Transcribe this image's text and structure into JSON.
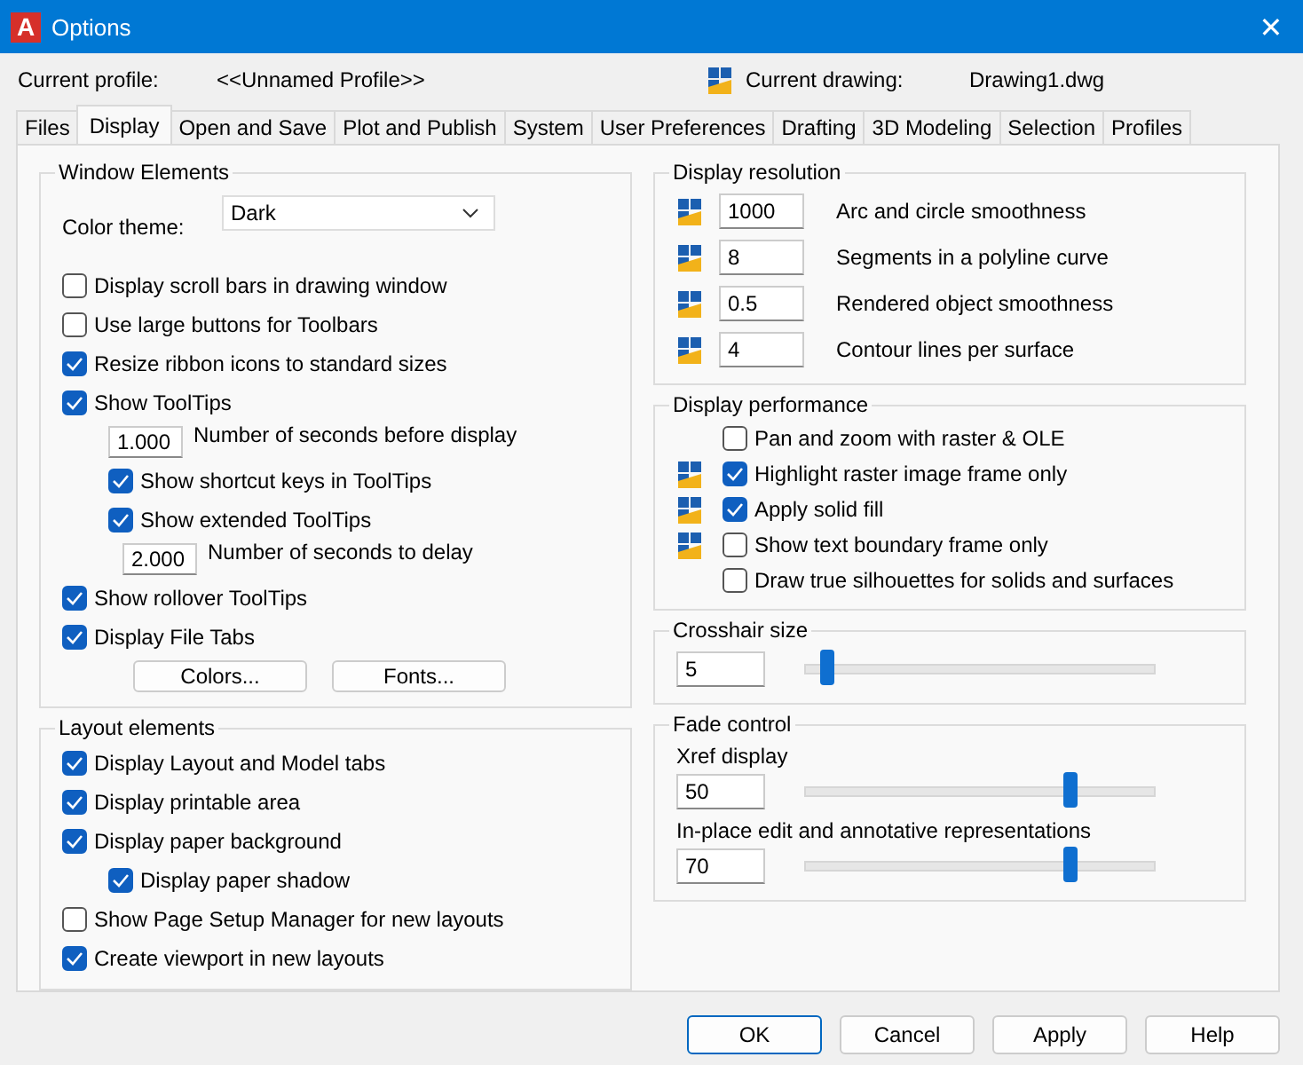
{
  "window": {
    "logo_letter": "A",
    "title": "Options",
    "close": "✕"
  },
  "profile": {
    "label": "Current profile:",
    "value": "<<Unnamed Profile>>",
    "drawing_label": "Current drawing:",
    "drawing_value": "Drawing1.dwg"
  },
  "tabs": [
    {
      "label": "Files",
      "selected": false
    },
    {
      "label": "Display",
      "selected": true
    },
    {
      "label": "Open and Save",
      "selected": false
    },
    {
      "label": "Plot and Publish",
      "selected": false
    },
    {
      "label": "System",
      "selected": false
    },
    {
      "label": "User Preferences",
      "selected": false
    },
    {
      "label": "Drafting",
      "selected": false
    },
    {
      "label": "3D Modeling",
      "selected": false
    },
    {
      "label": "Selection",
      "selected": false
    },
    {
      "label": "Profiles",
      "selected": false
    }
  ],
  "window_elements": {
    "title": "Window Elements",
    "items": [
      {
        "kind": "select",
        "label": "Color theme:",
        "value": "Dark"
      },
      {
        "kind": "checkbox",
        "label": "Display scroll bars in drawing window",
        "checked": false
      },
      {
        "kind": "checkbox",
        "label": "Use large buttons for Toolbars",
        "checked": false
      },
      {
        "kind": "checkbox",
        "label": "Resize ribbon icons to standard sizes",
        "checked": true
      },
      {
        "kind": "checkbox",
        "label": "Show ToolTips",
        "checked": true,
        "children": [
          {
            "kind": "number",
            "value": "1.000",
            "label": "Number of seconds before display"
          },
          {
            "kind": "checkbox",
            "label": "Show shortcut keys in ToolTips",
            "checked": true
          },
          {
            "kind": "checkbox",
            "label": "Show extended ToolTips",
            "checked": true,
            "children": [
              {
                "kind": "number",
                "value": "2.000",
                "label": "Number of seconds to delay"
              }
            ]
          }
        ]
      },
      {
        "kind": "checkbox",
        "label": "Show rollover ToolTips",
        "checked": true
      },
      {
        "kind": "checkbox",
        "label": "Display File Tabs",
        "checked": true
      },
      {
        "kind": "buttons",
        "labels": [
          "Colors...",
          "Fonts..."
        ]
      }
    ]
  },
  "layout_elements": {
    "title": "Layout elements",
    "items": [
      {
        "kind": "checkbox",
        "label": "Display Layout and Model tabs",
        "checked": true
      },
      {
        "kind": "checkbox",
        "label": "Display printable area",
        "checked": true
      },
      {
        "kind": "checkbox",
        "label": "Display paper background",
        "checked": true,
        "children": [
          {
            "kind": "checkbox",
            "label": "Display paper shadow",
            "checked": true
          }
        ]
      },
      {
        "kind": "checkbox",
        "label": "Show Page Setup Manager for new layouts",
        "checked": false
      },
      {
        "kind": "checkbox",
        "label": "Create viewport in new layouts",
        "checked": true
      }
    ]
  },
  "display_resolution": {
    "title": "Display resolution",
    "rows": [
      {
        "value": "1000",
        "label": "Arc and circle smoothness"
      },
      {
        "value": "8",
        "label": "Segments in a polyline curve"
      },
      {
        "value": "0.5",
        "label": "Rendered object smoothness"
      },
      {
        "value": "4",
        "label": "Contour lines per surface"
      }
    ]
  },
  "display_performance": {
    "title": "Display performance",
    "rows": [
      {
        "label": "Pan and zoom with raster & OLE",
        "checked": false,
        "drawing_icon": false
      },
      {
        "label": "Highlight raster image frame only",
        "checked": true,
        "drawing_icon": true
      },
      {
        "label": "Apply solid fill",
        "checked": true,
        "drawing_icon": true
      },
      {
        "label": "Show text boundary frame only",
        "checked": false,
        "drawing_icon": true
      },
      {
        "label": "Draw true silhouettes for solids and surfaces",
        "checked": false,
        "drawing_icon": false
      }
    ]
  },
  "crosshair": {
    "title": "Crosshair size",
    "value": "5",
    "level": 0.06
  },
  "fade_control": {
    "title": "Fade control",
    "sliders": [
      {
        "label": "Xref display",
        "value": "50",
        "level": 0.76
      },
      {
        "label": "In-place edit and annotative representations",
        "value": "70",
        "level": 0.76
      }
    ]
  },
  "buttons": [
    {
      "label": "OK",
      "default": true
    },
    {
      "label": "Cancel",
      "default": false
    },
    {
      "label": "Apply",
      "default": false
    },
    {
      "label": "Help",
      "default": false
    }
  ]
}
